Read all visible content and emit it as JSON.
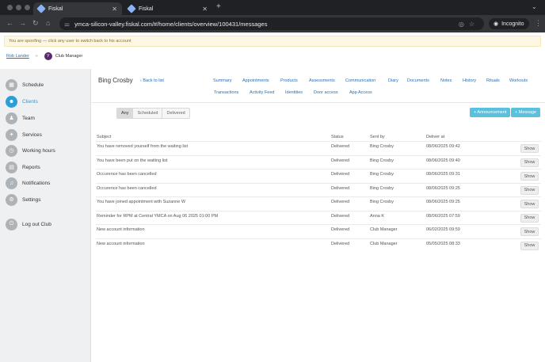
{
  "browser": {
    "tabs": [
      {
        "title": "Fiskal",
        "active": true
      },
      {
        "title": "Fiskal",
        "active": false
      }
    ],
    "new_tab": "+",
    "url": "ymca-silicon-valley.fiskal.com/#/home/clients/overview/100431/messages",
    "incognito_label": "Incognito"
  },
  "banner": {
    "text": "You are spoofing — click any user to switch back to his account"
  },
  "userbar": {
    "user_link": "Rob Lander",
    "separator": "»",
    "role": "Club Manager",
    "badge_letter": "Y"
  },
  "sidebar": {
    "items": [
      {
        "label": "Schedule",
        "icon": "▦"
      },
      {
        "label": "Clients",
        "icon": "☻"
      },
      {
        "label": "Team",
        "icon": "♟"
      },
      {
        "label": "Services",
        "icon": "✦"
      },
      {
        "label": "Working hours",
        "icon": "◷"
      },
      {
        "label": "Reports",
        "icon": "▤"
      },
      {
        "label": "Notifications",
        "icon": "♫"
      },
      {
        "label": "Settings",
        "icon": "⚙"
      },
      {
        "label": "Log out Club",
        "icon": "⏻"
      }
    ]
  },
  "client": {
    "name": "Bing Crosby",
    "back_label": "‹ Back to list"
  },
  "nav": {
    "row1": [
      "Summary",
      "Appointments",
      "Products",
      "Assessments",
      "Communication",
      "Diary",
      "Documents",
      "Notes",
      "History",
      "Rituals",
      "Workouts"
    ],
    "row2": [
      "Transactions",
      "Activity Feed",
      "Identities",
      "Door access",
      "App Access"
    ]
  },
  "filters": {
    "options": [
      "Any",
      "Scheduled",
      "Delivered"
    ],
    "selected": "Any"
  },
  "buttons": {
    "announcement": "+ Announcement",
    "message": "+ Message"
  },
  "table": {
    "headers": [
      "Subject",
      "Status",
      "Sent by",
      "Deliver at"
    ],
    "show_label": "Show",
    "rows": [
      {
        "subject": "You have removed yourself from the waiting list",
        "status": "Delivered",
        "sent_by": "Bing Crosby",
        "deliver_at": "08/06/2025 09:42"
      },
      {
        "subject": "You have been put on the waiting list",
        "status": "Delivered",
        "sent_by": "Bing Crosby",
        "deliver_at": "08/06/2025 09:40"
      },
      {
        "subject": "Occurence has been cancelled",
        "status": "Delivered",
        "sent_by": "Bing Crosby",
        "deliver_at": "08/06/2025 09:31"
      },
      {
        "subject": "Occurence has been cancelled",
        "status": "Delivered",
        "sent_by": "Bing Crosby",
        "deliver_at": "08/06/2025 09:25"
      },
      {
        "subject": "You have joined appointment with Suzanne W",
        "status": "Delivered",
        "sent_by": "Bing Crosby",
        "deliver_at": "08/06/2025 09:25"
      },
      {
        "subject": "Reminder for RPM at Central YMCA on Aug 06 2025 01:00 PM",
        "status": "Delivered",
        "sent_by": "Anna K",
        "deliver_at": "08/06/2025 07:59"
      },
      {
        "subject": "New account information",
        "status": "Delivered",
        "sent_by": "Club Manager",
        "deliver_at": "06/02/2025 09:59"
      },
      {
        "subject": "New account information",
        "status": "Delivered",
        "sent_by": "Club Manager",
        "deliver_at": "05/05/2025 08:33"
      }
    ]
  }
}
